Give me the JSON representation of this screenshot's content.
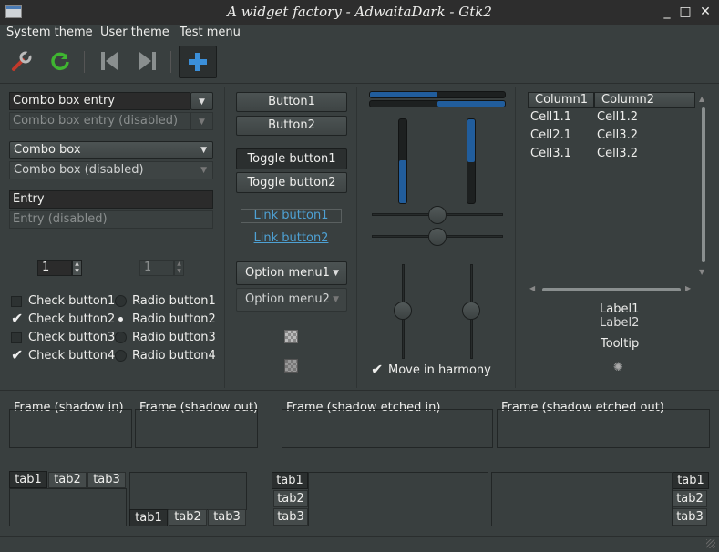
{
  "window": {
    "title": "A widget factory - AdwaitaDark - Gtk2",
    "minimize": "_",
    "maximize": "□",
    "close": "✕"
  },
  "menubar": {
    "items": [
      "System theme",
      "User theme",
      "Test menu"
    ]
  },
  "toolbar": {
    "icons": [
      "wrench-icon",
      "refresh-icon",
      "skip-back-icon",
      "skip-forward-icon",
      "add-icon"
    ]
  },
  "col1": {
    "combo_entry": "Combo box entry",
    "combo_entry_disabled": "Combo box entry (disabled)",
    "combo_box": "Combo box",
    "combo_box_disabled": "Combo box (disabled)",
    "entry": "Entry",
    "entry_disabled": "Entry (disabled)",
    "spin1": "1",
    "spin2": "1",
    "checks": [
      {
        "label": "Check button1",
        "checked": false
      },
      {
        "label": "Check button2",
        "checked": true
      },
      {
        "label": "Check button3",
        "checked": false
      },
      {
        "label": "Check button4",
        "checked": true
      }
    ],
    "radios": [
      {
        "label": "Radio button1",
        "selected": false
      },
      {
        "label": "Radio button2",
        "selected": true
      },
      {
        "label": "Radio button3",
        "selected": false
      },
      {
        "label": "Radio button4",
        "selected": false
      }
    ]
  },
  "col2": {
    "button1": "Button1",
    "button2": "Button2",
    "toggle1": "Toggle button1",
    "toggle2": "Toggle button2",
    "link1": "Link button1",
    "link2": "Link button2",
    "option1": "Option menu1",
    "option2": "Option menu2"
  },
  "col3": {
    "move_in_harmony": "Move in harmony"
  },
  "col4": {
    "columns": [
      "Column1",
      "Column2"
    ],
    "rows": [
      [
        "Cell1.1",
        "Cell1.2"
      ],
      [
        "Cell2.1",
        "Cell3.2"
      ],
      [
        "Cell3.1",
        "Cell3.2"
      ]
    ],
    "label1": "Label1",
    "label2": "Label2",
    "tooltip": "Tooltip"
  },
  "frames": [
    "Frame (shadow in)",
    "Frame (shadow out)",
    "Frame (shadow etched in)",
    "Frame (shadow etched out)"
  ],
  "tabs": [
    "tab1",
    "tab2",
    "tab3"
  ],
  "colors": {
    "accent": "#215d9c",
    "link": "#4ea1d4",
    "bg": "#393f3f"
  }
}
